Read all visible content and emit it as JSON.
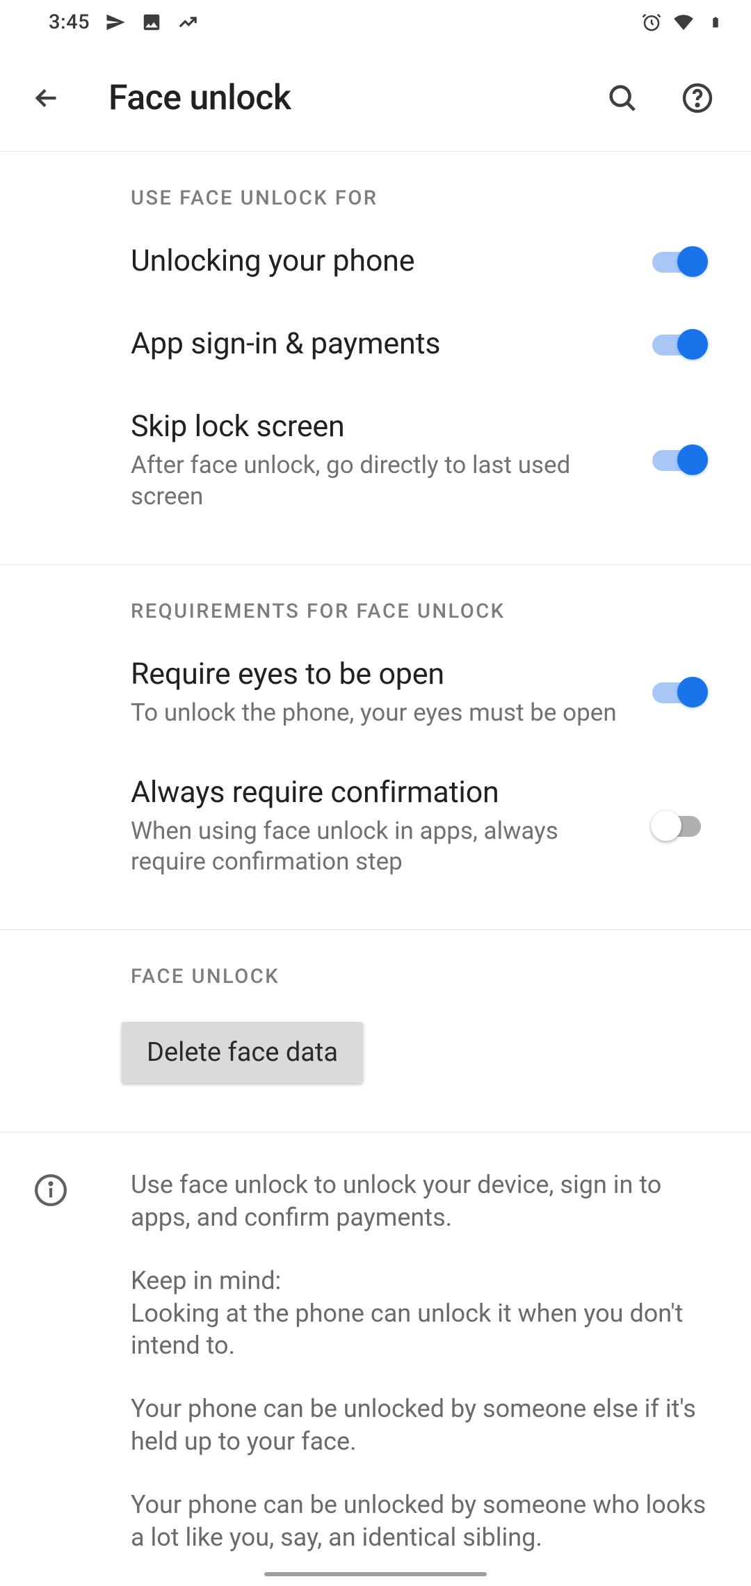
{
  "status": {
    "time": "3:45"
  },
  "appbar": {
    "title": "Face unlock"
  },
  "sections": [
    {
      "header": "USE FACE UNLOCK FOR",
      "items": [
        {
          "title": "Unlocking your phone",
          "sub": "",
          "on": true
        },
        {
          "title": "App sign-in & payments",
          "sub": "",
          "on": true
        },
        {
          "title": "Skip lock screen",
          "sub": "After face unlock, go directly to last used screen",
          "on": true
        }
      ]
    },
    {
      "header": "REQUIREMENTS FOR FACE UNLOCK",
      "items": [
        {
          "title": "Require eyes to be open",
          "sub": "To unlock the phone, your eyes must be open",
          "on": true
        },
        {
          "title": "Always require confirmation",
          "sub": "When using face unlock in apps, always require confirmation step",
          "on": false
        }
      ]
    }
  ],
  "face_unlock": {
    "header": "FACE UNLOCK",
    "delete_btn": "Delete face data"
  },
  "info": {
    "p1": "Use face unlock to unlock your device, sign in to apps, and confirm payments.",
    "p2a": "Keep in mind:",
    "p2b": "Looking at the phone can unlock it when you don't intend to.",
    "p3": "Your phone can be unlocked by someone else if it's held up to your face.",
    "p4": "Your phone can be unlocked by someone who looks a lot like you, say, an identical sibling."
  }
}
